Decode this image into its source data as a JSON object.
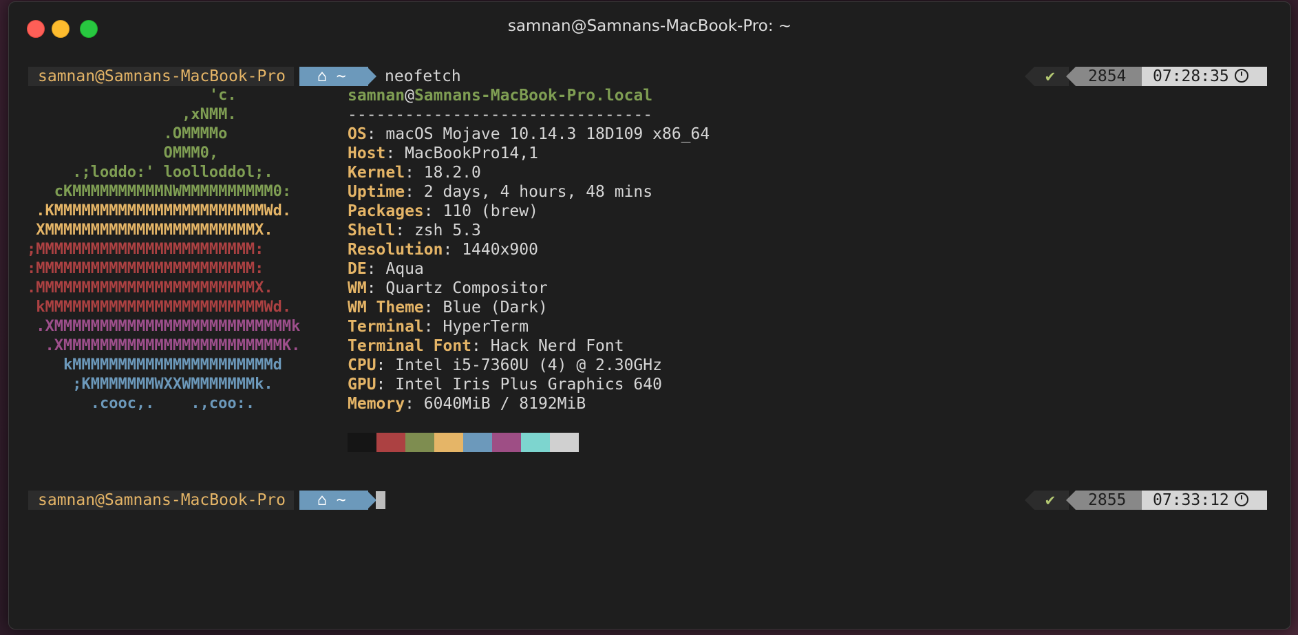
{
  "window": {
    "title": "samnan@Samnans-MacBook-Pro: ~"
  },
  "prompt1": {
    "user_host": "samnan@Samnans-MacBook-Pro",
    "home_glyph": "⌂",
    "dir": "~",
    "command": "neofetch",
    "status_check": "✔",
    "history_count": "2854",
    "time": "07:28:35"
  },
  "logo_lines": [
    {
      "text": "                    'c.",
      "color": "#7f9e53"
    },
    {
      "text": "                 ,xNMM.",
      "color": "#7f9e53"
    },
    {
      "text": "               .OMMMMo",
      "color": "#7f9e53"
    },
    {
      "text": "               OMMM0,",
      "color": "#7f9e53"
    },
    {
      "text": "     .;loddo:' loolloddol;.",
      "color": "#7f9e53"
    },
    {
      "text": "   cKMMMMMMMMMMNWMMMMMMMMMM0:",
      "color": "#7f9e53"
    },
    {
      "text": " .KMMMMMMMMMMMMMMMMMMMMMMMWd.",
      "color": "#e5b567"
    },
    {
      "text": " XMMMMMMMMMMMMMMMMMMMMMMMX.",
      "color": "#e5b567"
    },
    {
      "text": ";MMMMMMMMMMMMMMMMMMMMMMMM:",
      "color": "#ac4142"
    },
    {
      "text": ":MMMMMMMMMMMMMMMMMMMMMMMM:",
      "color": "#ac4142"
    },
    {
      "text": ".MMMMMMMMMMMMMMMMMMMMMMMMX.",
      "color": "#ac4142"
    },
    {
      "text": " kMMMMMMMMMMMMMMMMMMMMMMMMWd.",
      "color": "#ac4142"
    },
    {
      "text": " .XMMMMMMMMMMMMMMMMMMMMMMMMMMk",
      "color": "#9e4f8c"
    },
    {
      "text": "  .XMMMMMMMMMMMMMMMMMMMMMMMMK.",
      "color": "#9e4f8c"
    },
    {
      "text": "    kMMMMMMMMMMMMMMMMMMMMMMd",
      "color": "#6c99bb"
    },
    {
      "text": "     ;KMMMMMMMWXXWMMMMMMMk.",
      "color": "#6c99bb"
    },
    {
      "text": "       .cooc,.    .,coo:.",
      "color": "#6c99bb"
    }
  ],
  "info": {
    "user": "samnan",
    "at": "@",
    "host": "Samnans-MacBook-Pro.local",
    "separator": "--------------------------------",
    "rows": [
      {
        "key": "OS",
        "sep": ": ",
        "value": "macOS Mojave 10.14.3 18D109 x86_64"
      },
      {
        "key": "Host",
        "sep": ": ",
        "value": "MacBookPro14,1"
      },
      {
        "key": "Kernel",
        "sep": ": ",
        "value": "18.2.0"
      },
      {
        "key": "Uptime",
        "sep": ": ",
        "value": "2 days, 4 hours, 48 mins"
      },
      {
        "key": "Packages",
        "sep": ": ",
        "value": "110 (brew)"
      },
      {
        "key": "Shell",
        "sep": ": ",
        "value": "zsh 5.3"
      },
      {
        "key": "Resolution",
        "sep": ": ",
        "value": "1440x900"
      },
      {
        "key": "DE",
        "sep": ": ",
        "value": "Aqua"
      },
      {
        "key": "WM",
        "sep": ": ",
        "value": "Quartz Compositor"
      },
      {
        "key": "WM Theme",
        "sep": ": ",
        "value": "Blue (Dark)"
      },
      {
        "key": "Terminal",
        "sep": ": ",
        "value": "HyperTerm"
      },
      {
        "key": "Terminal Font",
        "sep": ": ",
        "value": "Hack Nerd Font"
      },
      {
        "key": "CPU",
        "sep": ": ",
        "value": "Intel i5-7360U (4) @ 2.30GHz"
      },
      {
        "key": "GPU",
        "sep": ": ",
        "value": "Intel Iris Plus Graphics 640"
      },
      {
        "key": "Memory",
        "sep": ": ",
        "value": "6040MiB / 8192MiB"
      }
    ],
    "palette": [
      "#151515",
      "#ac4142",
      "#7e8d50",
      "#e5b567",
      "#6c99bb",
      "#9e4e85",
      "#7dd5cf",
      "#d0d0d0"
    ]
  },
  "prompt2": {
    "user_host": "samnan@Samnans-MacBook-Pro",
    "home_glyph": "⌂",
    "dir": "~",
    "status_check": "✔",
    "history_count": "2855",
    "time": "07:33:12"
  }
}
